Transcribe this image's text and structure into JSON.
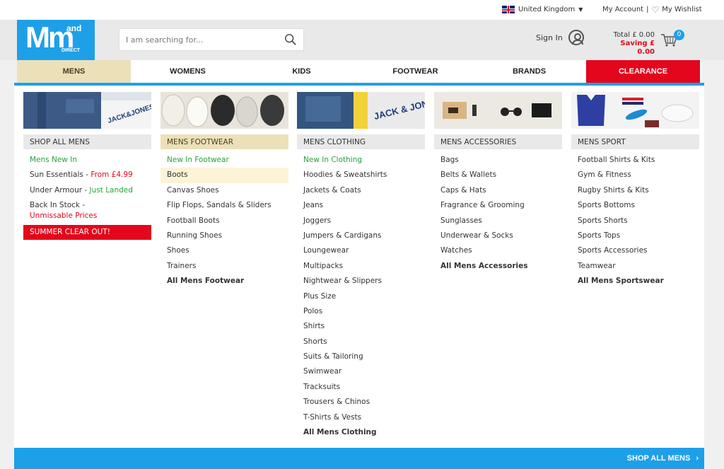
{
  "topbar": {
    "country": "United Kingdom",
    "my_account": "My Account",
    "separator": "|",
    "wishlist": "My Wishlist"
  },
  "logo": {
    "m": "Mm",
    "and": "and",
    "direct": "DIRECT"
  },
  "search": {
    "placeholder": "I am searching for..."
  },
  "account": {
    "sign_in": "Sign In",
    "total": "Total £ 0.00",
    "saving": "Saving £ 0.00",
    "basket_count": "0"
  },
  "nav": {
    "items": [
      "MENS",
      "WOMENS",
      "KIDS",
      "FOOTWEAR",
      "BRANDS",
      "CLEARANCE"
    ]
  },
  "columns": [
    {
      "heading": "SHOP ALL MENS",
      "image_text": "JACK&JONES"
    },
    {
      "heading": "MENS FOOTWEAR"
    },
    {
      "heading": "MENS CLOTHING",
      "image_text": "JACK & JONES"
    },
    {
      "heading": "MENS ACCESSORIES"
    },
    {
      "heading": "MENS SPORT"
    }
  ],
  "shop_all": {
    "new_in": "Mens New In",
    "sun_label": "Sun Essentials - ",
    "sun_price": "From £4.99",
    "ua_label": "Under Armour - ",
    "ua_tag": "Just Landed",
    "back_label": "Back In Stock -",
    "back_tag": "Unmissable Prices",
    "summer": "SUMMER CLEAR OUT!"
  },
  "footwear": [
    "New In Footwear",
    "Boots",
    "Canvas Shoes",
    "Flip Flops, Sandals & Sliders",
    "Football Boots",
    "Running Shoes",
    "Shoes",
    "Trainers",
    "All Mens Footwear"
  ],
  "clothing": [
    "New In Clothing",
    "Hoodies & Sweatshirts",
    "Jackets & Coats",
    "Jeans",
    "Joggers",
    "Jumpers & Cardigans",
    "Loungewear",
    "Multipacks",
    "Nightwear & Slippers",
    "Plus Size",
    "Polos",
    "Shirts",
    "Shorts",
    "Suits & Tailoring",
    "Swimwear",
    "Tracksuits",
    "Trousers & Chinos",
    "T-Shirts & Vests",
    "All Mens Clothing"
  ],
  "accessories": [
    "Bags",
    "Belts & Wallets",
    "Caps & Hats",
    "Fragrance & Grooming",
    "Sunglasses",
    "Underwear & Socks",
    "Watches",
    "All Mens Accessories"
  ],
  "sport": [
    "Football Shirts & Kits",
    "Gym & Fitness",
    "Rugby Shirts & Kits",
    "Sports Bottoms",
    "Sports Shorts",
    "Sports Tops",
    "Sports Accessories",
    "Teamwear",
    "All Mens Sportswear"
  ],
  "footer": {
    "label": "SHOP ALL MENS",
    "arrow": "›"
  },
  "colors": {
    "brand_blue": "#1ea0e8",
    "clearance_red": "#e4061c",
    "active_tan": "#ece0b9",
    "green": "#25a23c"
  }
}
